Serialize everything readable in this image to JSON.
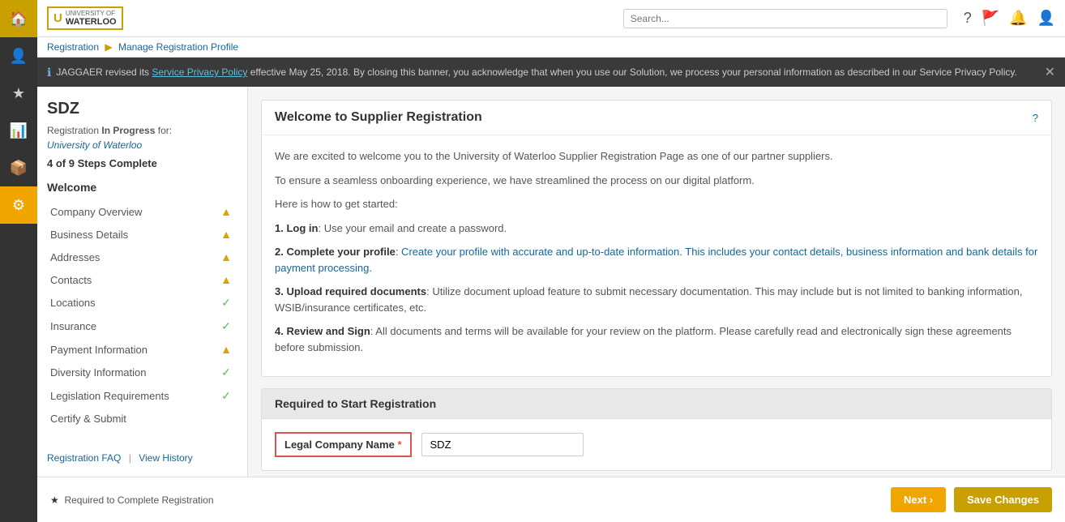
{
  "iconbar": {
    "items": [
      {
        "name": "home",
        "icon": "🏠",
        "active": true,
        "class": "home"
      },
      {
        "name": "user",
        "icon": "👤",
        "active": false
      },
      {
        "name": "gear",
        "icon": "⚙",
        "active": false,
        "class": "gear"
      },
      {
        "name": "chart",
        "icon": "📊",
        "active": false
      },
      {
        "name": "package",
        "icon": "📦",
        "active": false
      },
      {
        "name": "settings",
        "icon": "⚙",
        "active": false
      }
    ]
  },
  "topbar": {
    "logo_uw": "UNIVERSITY OF",
    "logo_waterloo": "WATERLOO",
    "search_placeholder": "Search...",
    "icons": [
      "?",
      "🚩",
      "🔔",
      "👤"
    ]
  },
  "breadcrumb": {
    "items": [
      "Registration",
      "Manage Registration Profile"
    ],
    "separator": "▶"
  },
  "banner": {
    "text": "JAGGAER revised its",
    "link_text": "Service Privacy Policy",
    "text2": "effective May 25, 2018. By closing this banner, you acknowledge that when you use our Solution, we process your personal information as described in our Service Privacy Policy."
  },
  "sidebar": {
    "company_name": "SDZ",
    "status_prefix": "Registration",
    "status_bold": "In Progress",
    "status_suffix": "for:",
    "university": "University of Waterloo",
    "steps": "4 of 9 Steps Complete",
    "section_title": "Welcome",
    "menu_items": [
      {
        "label": "Company Overview",
        "icon": "warning",
        "icon_char": "▲"
      },
      {
        "label": "Business Details",
        "icon": "warning",
        "icon_char": "▲"
      },
      {
        "label": "Addresses",
        "icon": "warning",
        "icon_char": "▲"
      },
      {
        "label": "Contacts",
        "icon": "warning",
        "icon_char": "▲"
      },
      {
        "label": "Locations",
        "icon": "check",
        "icon_char": "✓"
      },
      {
        "label": "Insurance",
        "icon": "check",
        "icon_char": "✓"
      },
      {
        "label": "Payment Information",
        "icon": "warning",
        "icon_char": "▲"
      },
      {
        "label": "Diversity Information",
        "icon": "check",
        "icon_char": "✓"
      },
      {
        "label": "Legislation Requirements",
        "icon": "check",
        "icon_char": "✓"
      },
      {
        "label": "Certify & Submit",
        "icon": "none",
        "icon_char": ""
      }
    ],
    "link1": "Registration FAQ",
    "link2": "View History"
  },
  "welcome_card": {
    "title": "Welcome to Supplier Registration",
    "help_label": "?",
    "para1": "We are excited to welcome you to the University of Waterloo Supplier Registration Page as one of our partner suppliers.",
    "para2": "To ensure a seamless onboarding experience, we have streamlined the process on our digital platform.",
    "para3": "Here is how to get started:",
    "steps": [
      {
        "num": "1.",
        "bold": "Log in",
        "text": ": Use your email and create a password."
      },
      {
        "num": "2.",
        "bold": "Complete your profile",
        "text": ": Create your profile with accurate and up-to-date information. This includes your contact details, business information and bank details for payment processing."
      },
      {
        "num": "3.",
        "bold": "Upload required documents",
        "text": ": Utilize document upload feature to submit necessary documentation. This may include but is not limited to banking information, WSIB/insurance certificates, etc."
      },
      {
        "num": "4.",
        "bold": "Review and Sign",
        "text": ": All documents and terms will be available for your review on the platform. Please carefully read and electronically sign these agreements before submission."
      }
    ]
  },
  "required_section": {
    "title": "Required to Start Registration",
    "label": "Legal Company Name",
    "required_star": "*",
    "input_value": "SDZ"
  },
  "footer": {
    "note_star": "★",
    "note_text": "Required to Complete Registration",
    "next_label": "Next ›",
    "save_label": "Save Changes"
  }
}
